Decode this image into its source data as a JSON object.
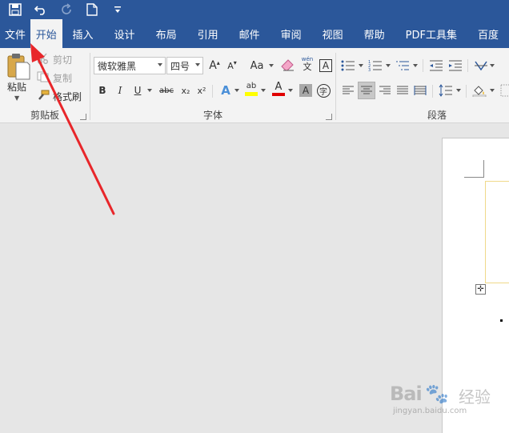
{
  "qat": {
    "save_icon": "save-icon",
    "undo_icon": "undo-icon",
    "redo_icon": "redo-icon",
    "new_icon": "new-document-icon",
    "customize_icon": "customize-qat-icon"
  },
  "tabs": [
    {
      "label": "文件"
    },
    {
      "label": "开始"
    },
    {
      "label": "插入"
    },
    {
      "label": "设计"
    },
    {
      "label": "布局"
    },
    {
      "label": "引用"
    },
    {
      "label": "邮件"
    },
    {
      "label": "审阅"
    },
    {
      "label": "视图"
    },
    {
      "label": "帮助"
    },
    {
      "label": "PDF工具集"
    },
    {
      "label": "百度"
    }
  ],
  "clipboard": {
    "paste_label": "粘贴",
    "cut_label": "剪切",
    "copy_label": "复制",
    "format_painter_label": "格式刷",
    "group_label": "剪贴板"
  },
  "font": {
    "font_name": "微软雅黑",
    "font_size": "四号",
    "grow_label": "A",
    "shrink_label": "A",
    "case_label": "Aa",
    "phonetic_top": "wén",
    "phonetic_bottom": "文",
    "border_label": "A",
    "bold": "B",
    "italic": "I",
    "underline": "U",
    "strike": "abc",
    "sub": "x₂",
    "sup": "x²",
    "effect_label": "A",
    "highlight_label": "ab",
    "color_label": "A",
    "shade_label": "A",
    "enclose_label": "字",
    "group_label": "字体"
  },
  "paragraph": {
    "group_label": "段落"
  },
  "colors": {
    "title_bar": "#2b579a",
    "ribbon": "#f3f3f3",
    "canvas": "#e6e6e6",
    "arrow": "#e8262a",
    "highlight": "#ffff00",
    "font_color": "#e00000"
  },
  "watermark": {
    "logo": "Bai",
    "logo_suffix": "经验",
    "url": "jingyan.baidu.com"
  }
}
